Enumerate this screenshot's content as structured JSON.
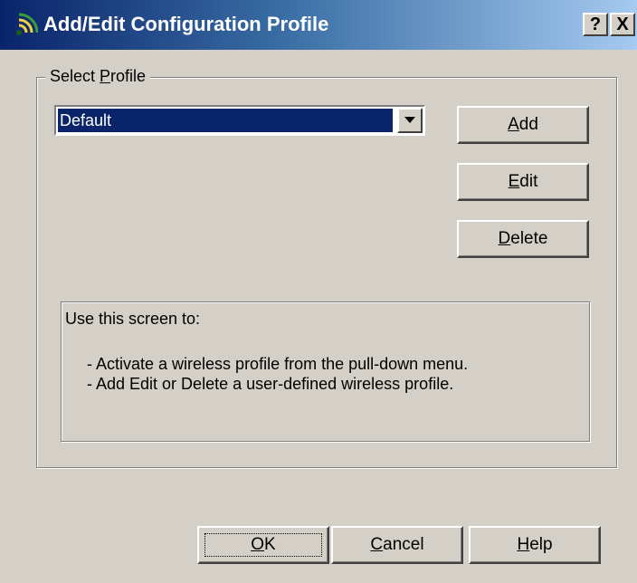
{
  "window": {
    "title": "Add/Edit Configuration Profile",
    "help_button": "?",
    "close_button": "X",
    "icon": "wireless-signal-icon"
  },
  "profile_group": {
    "label_prefix": "Select ",
    "label_accel": "P",
    "label_rest": "rofile",
    "selected_profile": "Default",
    "dropdown_icon": "chevron-down-icon"
  },
  "side_buttons": {
    "add": {
      "accel": "A",
      "rest": "dd"
    },
    "edit": {
      "accel": "E",
      "rest": "dit"
    },
    "delete": {
      "accel": "D",
      "rest": "elete"
    }
  },
  "info": {
    "heading": "Use this screen to:",
    "line1": "- Activate a wireless profile from the pull-down menu.",
    "line2": "- Add Edit or Delete a user-defined wireless profile."
  },
  "bottom_buttons": {
    "ok": {
      "accel": "O",
      "rest": "K"
    },
    "cancel": {
      "accel": "C",
      "rest": "ancel"
    },
    "help": {
      "accel": "H",
      "rest": "elp"
    }
  },
  "colors": {
    "window_bg": "#d4d0c8",
    "title_start": "#0a246a",
    "title_end": "#a6caf0",
    "selection_bg": "#0a246a"
  }
}
